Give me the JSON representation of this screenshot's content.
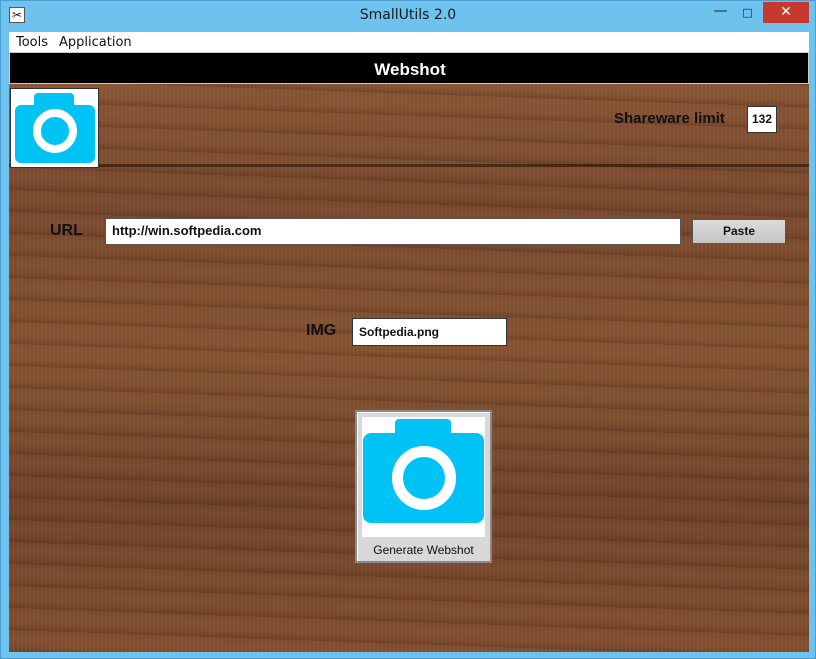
{
  "window": {
    "title": "SmallUtils 2.0",
    "minimize_glyph": "—",
    "maximize_glyph": "□",
    "close_glyph": "✕",
    "app_icon": "crossed-tools-icon"
  },
  "menu": {
    "items": [
      {
        "label": "Tools"
      },
      {
        "label": "Application"
      }
    ]
  },
  "header": {
    "title": "Webshot"
  },
  "logo": {
    "icon": "camera-icon",
    "color": "#00c3f5"
  },
  "shareware": {
    "label": "Shareware limit",
    "count": "132"
  },
  "url": {
    "label": "URL",
    "value": "http://win.softpedia.com",
    "paste_label": "Paste"
  },
  "img": {
    "label": "IMG",
    "value": "Softpedia.png"
  },
  "generate": {
    "label": "Generate Webshot",
    "icon": "camera-icon"
  },
  "colors": {
    "header_bg": "#000000",
    "titlebar": "#6dc3ee",
    "close_button": "#c7392f",
    "wood": "#7a4a2c"
  }
}
